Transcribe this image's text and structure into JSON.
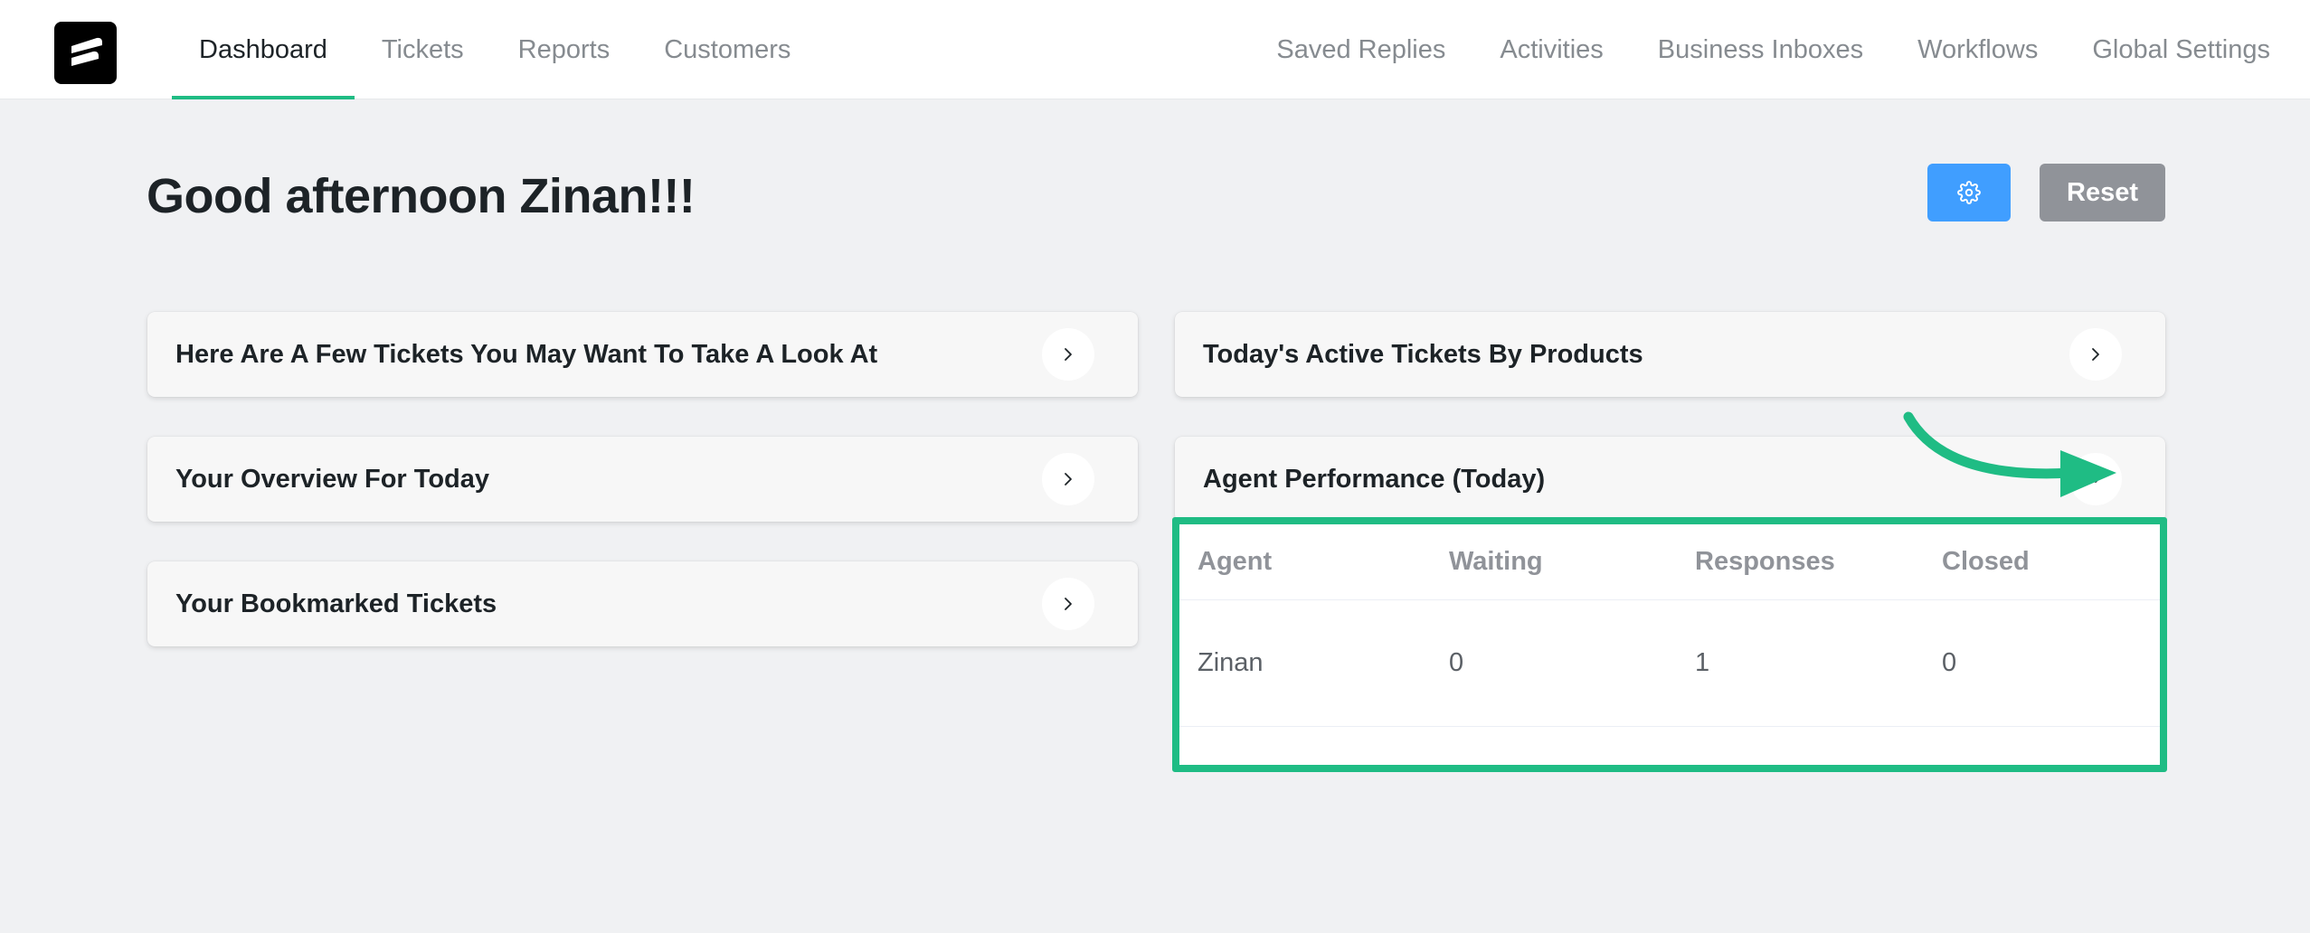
{
  "nav": {
    "left": [
      "Dashboard",
      "Tickets",
      "Reports",
      "Customers"
    ],
    "right": [
      "Saved Replies",
      "Activities",
      "Business Inboxes",
      "Workflows",
      "Global Settings"
    ],
    "active": "Dashboard"
  },
  "header": {
    "greeting": "Good afternoon Zinan!!!",
    "reset_label": "Reset"
  },
  "cards": {
    "tickets_look": "Here Are A Few Tickets You May Want To Take A Look At",
    "overview": "Your Overview For Today",
    "bookmarked": "Your Bookmarked Tickets",
    "active_products": "Today's Active Tickets By Products",
    "agent_performance": "Agent Performance (Today)"
  },
  "agent_table": {
    "columns": [
      "Agent",
      "Waiting",
      "Responses",
      "Closed"
    ],
    "rows": [
      {
        "agent": "Zinan",
        "waiting": "0",
        "responses": "1",
        "closed": "0"
      }
    ]
  },
  "icons": {
    "logo": "fluent-support-logo",
    "settings": "gear-icon",
    "expand": "chevron-right-icon",
    "collapse": "chevron-down-icon",
    "annotation": "curved-arrow-icon"
  },
  "colors": {
    "accent": "#1fbc84",
    "primary_button": "#409eff",
    "reset_button": "#909399",
    "background": "#f0f1f3"
  }
}
